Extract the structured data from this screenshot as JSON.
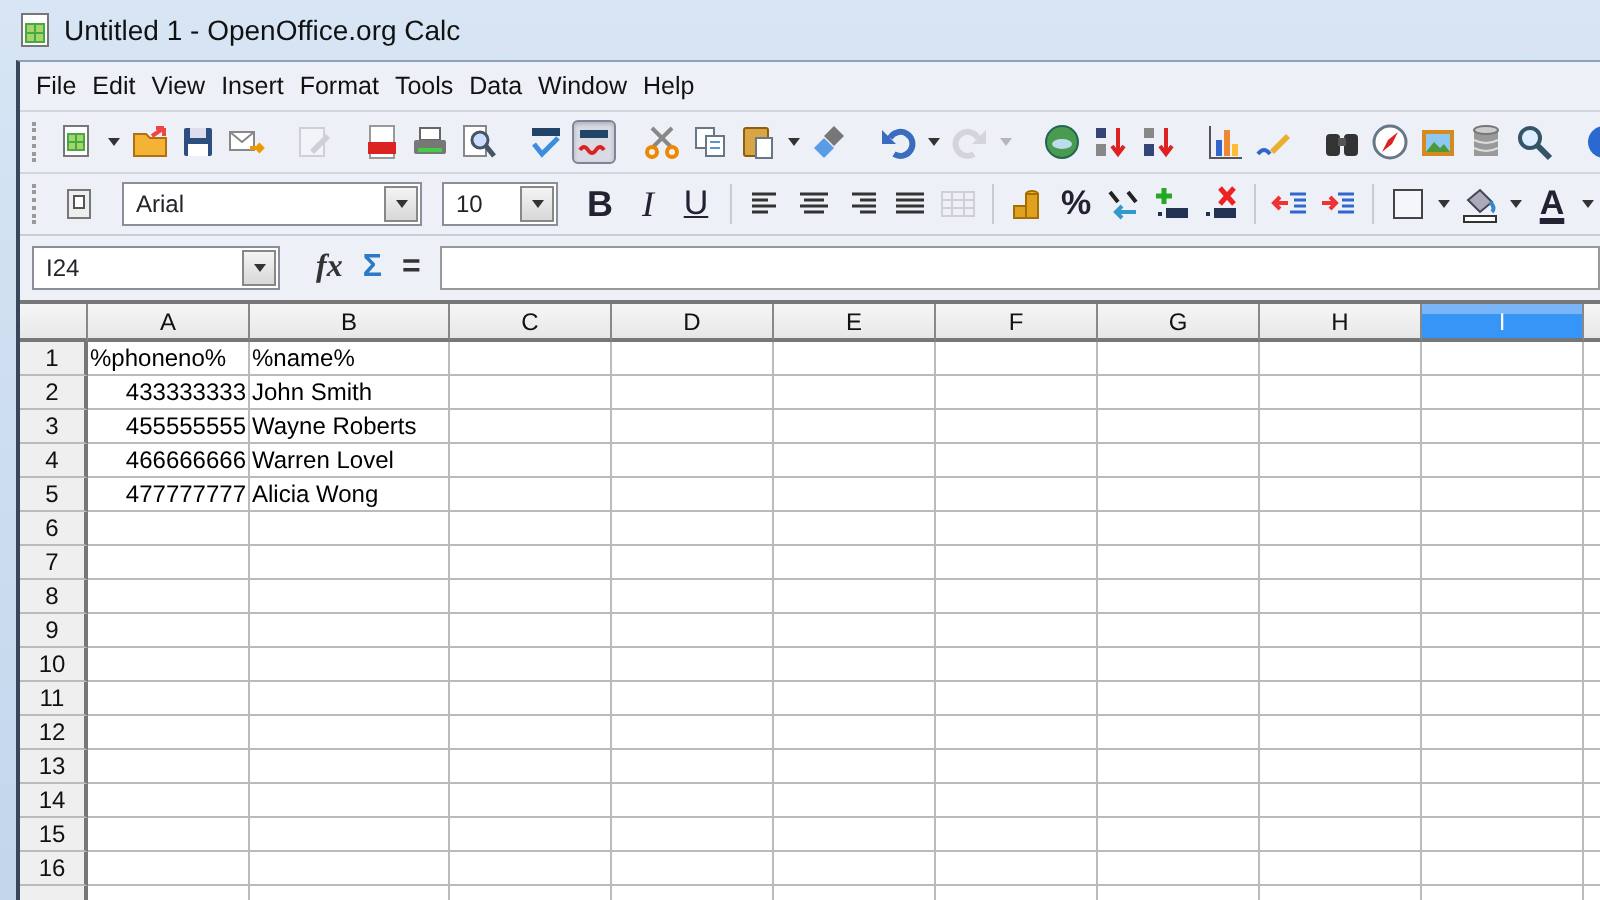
{
  "window": {
    "title": "Untitled 1 - OpenOffice.org Calc"
  },
  "menu": [
    "File",
    "Edit",
    "View",
    "Insert",
    "Format",
    "Tools",
    "Data",
    "Window",
    "Help"
  ],
  "standard_toolbar": [
    [
      {
        "kind": "new-spreadsheet",
        "disabled": false,
        "pressed": false
      },
      {
        "kind": "caret",
        "disabled": false,
        "pressed": false
      },
      {
        "kind": "folder",
        "disabled": false,
        "pressed": false
      },
      {
        "kind": "floppy-disk",
        "disabled": false,
        "pressed": false
      },
      {
        "kind": "envelope",
        "disabled": false,
        "pressed": false
      }
    ],
    [
      {
        "kind": "edit-document",
        "disabled": true,
        "pressed": false
      }
    ],
    [
      {
        "kind": "pdf",
        "disabled": false,
        "pressed": false
      },
      {
        "kind": "printer",
        "disabled": false,
        "pressed": false
      },
      {
        "kind": "preview",
        "disabled": false,
        "pressed": false
      }
    ],
    [
      {
        "kind": "spellcheck",
        "disabled": false,
        "pressed": false
      },
      {
        "kind": "autospellcheck",
        "disabled": false,
        "pressed": true
      }
    ],
    [
      {
        "kind": "scissors",
        "disabled": false,
        "pressed": false
      },
      {
        "kind": "copy",
        "disabled": false,
        "pressed": false
      },
      {
        "kind": "paste",
        "disabled": false,
        "pressed": false
      },
      {
        "kind": "caret",
        "disabled": false,
        "pressed": false
      },
      {
        "kind": "brush",
        "disabled": false,
        "pressed": false
      }
    ],
    [
      {
        "kind": "undo",
        "disabled": false,
        "pressed": false
      },
      {
        "kind": "caret",
        "disabled": false,
        "pressed": false
      },
      {
        "kind": "redo",
        "disabled": true,
        "pressed": false
      },
      {
        "kind": "caret",
        "disabled": true,
        "pressed": false
      }
    ],
    [
      {
        "kind": "globe",
        "disabled": false,
        "pressed": false
      },
      {
        "kind": "sort-ascending",
        "disabled": false,
        "pressed": false
      },
      {
        "kind": "sort-descending",
        "disabled": false,
        "pressed": false
      }
    ],
    [
      {
        "kind": "bar-chart",
        "disabled": false,
        "pressed": false
      },
      {
        "kind": "pencil",
        "disabled": false,
        "pressed": false
      }
    ],
    [
      {
        "kind": "binoculars",
        "disabled": false,
        "pressed": false
      },
      {
        "kind": "compass",
        "disabled": false,
        "pressed": false
      },
      {
        "kind": "picture-frame",
        "disabled": false,
        "pressed": false
      },
      {
        "kind": "database",
        "disabled": false,
        "pressed": false
      },
      {
        "kind": "magnifier",
        "disabled": false,
        "pressed": false
      }
    ],
    [
      {
        "kind": "help",
        "disabled": false,
        "pressed": false
      }
    ]
  ],
  "formatting_toolbar": {
    "font_name": "Arial",
    "font_size": "10",
    "groups": [
      [
        {
          "kind": "bold",
          "label": "B",
          "disabled": false
        },
        {
          "kind": "italic",
          "label": "I",
          "disabled": false
        },
        {
          "kind": "underline",
          "label": "U",
          "disabled": false
        }
      ],
      [
        {
          "kind": "align-left",
          "disabled": false
        },
        {
          "kind": "align-center",
          "disabled": false
        },
        {
          "kind": "align-right",
          "disabled": false
        },
        {
          "kind": "justify",
          "disabled": false
        },
        {
          "kind": "table-grid",
          "disabled": true
        }
      ],
      [
        {
          "kind": "coins",
          "disabled": false
        },
        {
          "kind": "percent",
          "label": "%",
          "disabled": false
        },
        {
          "kind": "number-format",
          "disabled": false
        },
        {
          "kind": "add-decimal",
          "disabled": false
        },
        {
          "kind": "delete-decimal",
          "disabled": false
        }
      ],
      [
        {
          "kind": "indent-decrease",
          "disabled": false
        },
        {
          "kind": "indent-increase",
          "disabled": false
        }
      ],
      [
        {
          "kind": "border",
          "disabled": false
        },
        {
          "kind": "caret",
          "disabled": false
        },
        {
          "kind": "paint-bucket",
          "disabled": false
        },
        {
          "kind": "caret",
          "disabled": false
        },
        {
          "kind": "font-color",
          "label": "A",
          "disabled": false
        },
        {
          "kind": "caret",
          "disabled": false
        }
      ]
    ]
  },
  "formula_bar": {
    "name_box": "I24",
    "function_wizard": "fx",
    "sum": "Σ",
    "equals": "="
  },
  "columns": [
    {
      "label": "A",
      "selected": false
    },
    {
      "label": "B",
      "selected": false
    },
    {
      "label": "C",
      "selected": false
    },
    {
      "label": "D",
      "selected": false
    },
    {
      "label": "E",
      "selected": false
    },
    {
      "label": "F",
      "selected": false
    },
    {
      "label": "G",
      "selected": false
    },
    {
      "label": "H",
      "selected": false
    },
    {
      "label": "I",
      "selected": true
    }
  ],
  "rows": [
    {
      "label": "1",
      "cells": [
        {
          "text": "%phoneno%",
          "kind": "text"
        },
        {
          "text": "%name%",
          "kind": "text"
        }
      ]
    },
    {
      "label": "2",
      "cells": [
        {
          "text": "433333333",
          "kind": "number"
        },
        {
          "text": "John Smith",
          "kind": "text"
        }
      ]
    },
    {
      "label": "3",
      "cells": [
        {
          "text": "455555555",
          "kind": "number"
        },
        {
          "text": "Wayne Roberts",
          "kind": "text"
        }
      ]
    },
    {
      "label": "4",
      "cells": [
        {
          "text": "466666666",
          "kind": "number"
        },
        {
          "text": "Warren Lovel",
          "kind": "text"
        }
      ]
    },
    {
      "label": "5",
      "cells": [
        {
          "text": "477777777",
          "kind": "number"
        },
        {
          "text": "Alicia Wong",
          "kind": "text"
        }
      ]
    },
    {
      "label": "6"
    },
    {
      "label": "7"
    },
    {
      "label": "8"
    },
    {
      "label": "9"
    },
    {
      "label": "10"
    },
    {
      "label": "11"
    },
    {
      "label": "12"
    },
    {
      "label": "13"
    },
    {
      "label": "14"
    },
    {
      "label": "15"
    },
    {
      "label": "16"
    },
    {}
  ]
}
